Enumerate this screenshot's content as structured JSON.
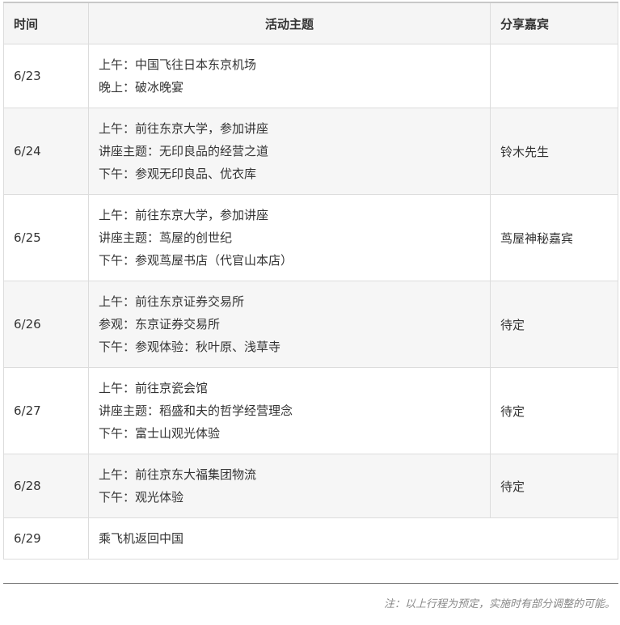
{
  "table": {
    "headers": {
      "date": "时间",
      "topic": "活动主题",
      "guest": "分享嘉宾"
    },
    "rows": [
      {
        "date": "6/23",
        "topic": [
          "上午：中国飞往日本东京机场",
          "晚上：破冰晚宴"
        ],
        "guest": ""
      },
      {
        "date": "6/24",
        "topic": [
          "上午：前往东京大学，参加讲座",
          "讲座主题：无印良品的经营之道",
          "下午：参观无印良品、优衣库"
        ],
        "guest": "铃木先生"
      },
      {
        "date": "6/25",
        "topic": [
          "上午：前往东京大学，参加讲座",
          "讲座主题：茑屋的创世纪",
          "下午：参观茑屋书店（代官山本店）"
        ],
        "guest": "茑屋神秘嘉宾"
      },
      {
        "date": "6/26",
        "topic": [
          "上午：前往东京证券交易所",
          "参观：东京证券交易所",
          "下午：参观体验：秋叶原、浅草寺"
        ],
        "guest": "待定"
      },
      {
        "date": "6/27",
        "topic": [
          "上午：前往京瓷会馆",
          "讲座主题：稻盛和夫的哲学经营理念",
          "下午：富士山观光体验"
        ],
        "guest": "待定"
      },
      {
        "date": "6/28",
        "topic": [
          "上午：前往京东大福集团物流",
          "下午：观光体验"
        ],
        "guest": "待定"
      },
      {
        "date": "6/29",
        "topic": [
          "乘飞机返回中国"
        ],
        "guest": ""
      }
    ]
  },
  "footer": {
    "note": "注：以上行程为预定，实施时有部分调整的可能。"
  }
}
